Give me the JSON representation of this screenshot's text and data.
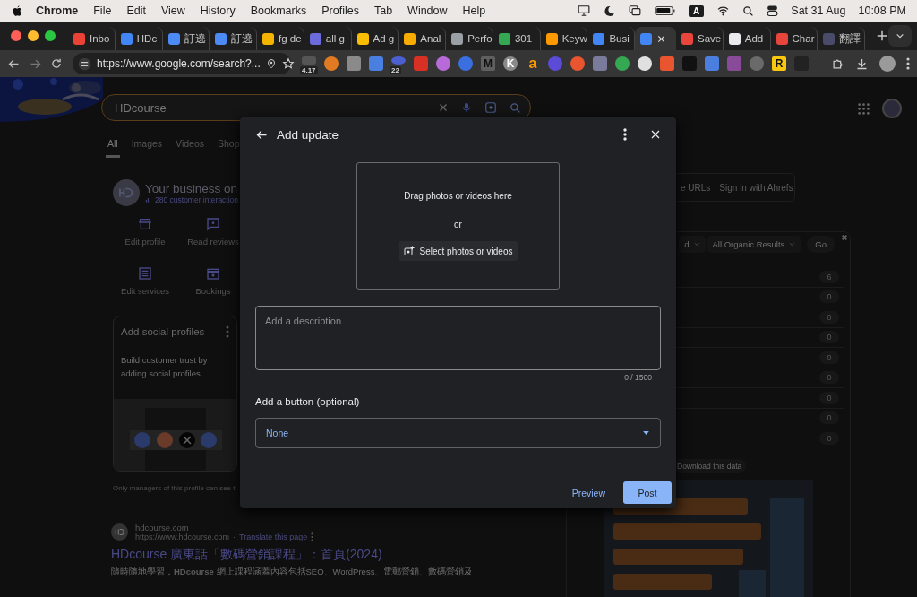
{
  "menu_bar": {
    "app": "Chrome",
    "menus": [
      "File",
      "Edit",
      "View",
      "History",
      "Bookmarks",
      "Profiles",
      "Tab",
      "Window",
      "Help"
    ],
    "input_source": "A",
    "date": "Sat 31 Aug",
    "time": "10:08 PM"
  },
  "tabs": [
    {
      "title": "Inbo",
      "color": "#ea4335",
      "selected": false
    },
    {
      "title": "HDc",
      "color": "#4285f4",
      "selected": false
    },
    {
      "title": "訂遶",
      "color": "#4c8bf5",
      "selected": false
    },
    {
      "title": "訂遶",
      "color": "#4c8bf5",
      "selected": false
    },
    {
      "title": "fg de",
      "color": "#f4b400",
      "selected": false
    },
    {
      "title": "all g",
      "color": "#6b6bdc",
      "selected": false
    },
    {
      "title": "Ad g",
      "color": "#fbbc04",
      "selected": false
    },
    {
      "title": "Anal",
      "color": "#f9ab00",
      "selected": false
    },
    {
      "title": "Perfo",
      "color": "#9aa0a6",
      "selected": false
    },
    {
      "title": "301",
      "color": "#34a853",
      "selected": false
    },
    {
      "title": "Keyw",
      "color": "#ff9900",
      "selected": false
    },
    {
      "title": "Busi",
      "color": "#4285f4",
      "selected": false
    },
    {
      "color": "#4285f4",
      "selected": true
    },
    {
      "title": "Save",
      "color": "#e8453c",
      "selected": false
    },
    {
      "title": "Add",
      "color": "#e8eaed",
      "selected": false
    },
    {
      "title": "Char",
      "color": "#e8453c",
      "selected": false
    },
    {
      "title": "翻譯",
      "color": "#4a4a6a",
      "selected": false
    }
  ],
  "toolbar": {
    "url": "https://www.google.com/search?...",
    "extensions": [
      {
        "kind": "tile",
        "color": "#555555",
        "badge": "4.17"
      },
      {
        "kind": "dot",
        "color": "#e07b24"
      },
      {
        "kind": "tile",
        "color": "#8a8a8a"
      },
      {
        "kind": "tile",
        "color": "#4a7fe0"
      },
      {
        "kind": "dot",
        "color": "#4b5fd1",
        "badge": "22"
      },
      {
        "kind": "tile",
        "color": "#d93025"
      },
      {
        "kind": "dot",
        "color": "#b86ad8"
      },
      {
        "kind": "dot",
        "color": "#3b6fe0"
      },
      {
        "kind": "lettertile",
        "color": "#5f5f5f",
        "label": "M"
      },
      {
        "kind": "letterdot",
        "color": "#8a8a8a",
        "label": "K"
      },
      {
        "kind": "letter",
        "color": "#ff9900",
        "label": "a"
      },
      {
        "kind": "dot",
        "color": "#5b4bd6"
      },
      {
        "kind": "dot",
        "color": "#e8552f"
      },
      {
        "kind": "tile",
        "color": "#7a7a9a"
      },
      {
        "kind": "dot",
        "color": "#34a853"
      },
      {
        "kind": "dot",
        "color": "#e0e0e0"
      },
      {
        "kind": "tile",
        "color": "#e8552f"
      },
      {
        "kind": "tile",
        "color": "#111111"
      },
      {
        "kind": "tile",
        "color": "#4a7fe0"
      },
      {
        "kind": "tile",
        "color": "#8a4a9a"
      },
      {
        "kind": "dot",
        "color": "#6a6a6a"
      },
      {
        "kind": "lettertile",
        "color": "#f9c80e",
        "label": "R"
      },
      {
        "kind": "tile",
        "color": "#222222"
      }
    ]
  },
  "search": {
    "query": "HDcourse"
  },
  "search_tabs": [
    {
      "label": "All",
      "selected": true
    },
    {
      "label": "Images",
      "selected": false
    },
    {
      "label": "Videos",
      "selected": false
    },
    {
      "label": "Shop",
      "selected": false
    }
  ],
  "business": {
    "title": "Your business on",
    "interactions": "280 customer interaction",
    "actions": [
      {
        "label": "Edit profile",
        "kind": "store"
      },
      {
        "label": "Read reviews",
        "kind": "review"
      },
      {
        "label": "Edit services",
        "kind": "list"
      },
      {
        "label": "Bookings",
        "kind": "calendar"
      }
    ],
    "card": {
      "title": "Add social profiles",
      "text": "Build customer trust by adding social profiles"
    },
    "note": "Only managers of this profile can see t"
  },
  "result": {
    "site": "hdcourse.com",
    "url": "https://www.hdcourse.com",
    "dot": "·",
    "translate": "Translate this page",
    "title": "HDcourse 廣東話「數碼營銷課程」：首頁(2024)",
    "snippet": "隨時隨地學習，**HDcourse** 網上課程涵蓋內容包括SEO、WordPress、電郵營銷、數碼營銷及"
  },
  "seo_panel": {
    "links": [
      "e URLs",
      "Sign in with Ahrefs"
    ],
    "filters": [
      "d",
      "All Organic Results"
    ],
    "go": "Go",
    "counts": [
      "6",
      "0",
      "0",
      "0",
      "0",
      "0",
      "0",
      "0",
      "0"
    ],
    "download": "Download this data"
  },
  "dialog": {
    "title": "Add update",
    "drop_text": "Drag photos or videos here",
    "or": "or",
    "select_button": "Select photos or videos",
    "description": {
      "placeholder": "Add a description"
    },
    "counter": "0 / 1500",
    "button_label": "Add a button (optional)",
    "button_select": {
      "value": "None"
    },
    "actions": [
      "Preview",
      "Post"
    ]
  }
}
